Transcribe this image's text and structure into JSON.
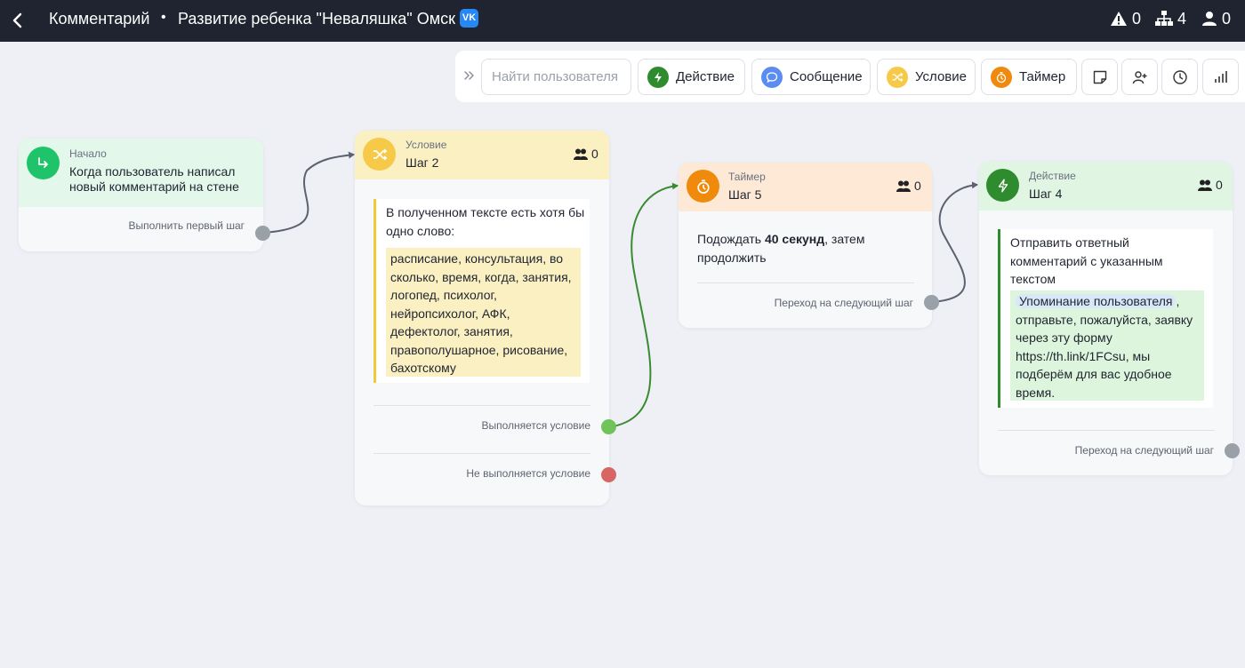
{
  "header": {
    "title": "Комментарий",
    "separator": "•",
    "project": "Развитие ребенка \"Неваляшка\" Омск",
    "vk_badge": "VK",
    "stats": {
      "warnings": "0",
      "steps": "4",
      "users": "0"
    }
  },
  "toolbar": {
    "search_placeholder": "Найти пользователя",
    "action": "Действие",
    "message": "Сообщение",
    "condition": "Условие",
    "timer": "Таймер"
  },
  "colors": {
    "topbar": "#1f2430",
    "green": "#2e8b2e",
    "blue": "#5b8cf0",
    "yellow": "#f7c948",
    "orange": "#f08a0c",
    "start_green": "#1fc46a"
  },
  "nodes": {
    "start": {
      "label": "Начало",
      "title": "Когда пользователь написал новый комментарий на стене",
      "output": "Выполнить первый шаг"
    },
    "condition": {
      "type_label": "Условие",
      "title": "Шаг 2",
      "count": "0",
      "text": "В полученном тексте есть хотя бы одно слово:",
      "keywords": "расписание, консультация, во сколько, время, когда, занятия, логопед, психолог, нейропсихолог, АФК, дефектолог, занятия, правополушарное, рисование, бахотскому",
      "out_true": "Выполняется условие",
      "out_false": "Не выполняется условие"
    },
    "timer": {
      "type_label": "Таймер",
      "title": "Шаг 5",
      "count": "0",
      "text_before": "Подождать ",
      "text_bold": "40 секунд",
      "text_after": ", затем продолжить",
      "output": "Переход на следующий шаг"
    },
    "action": {
      "type_label": "Действие",
      "title": "Шаг 4",
      "count": "0",
      "text": "Отправить ответный комментарий с указанным текстом",
      "mention": "Упоминание пользователя",
      "message": ", отправьте, пожалуйста, заявку через эту форму https://th.link/1FCsu, мы подберём для вас удобное время.",
      "output": "Переход на следующий шаг"
    }
  }
}
